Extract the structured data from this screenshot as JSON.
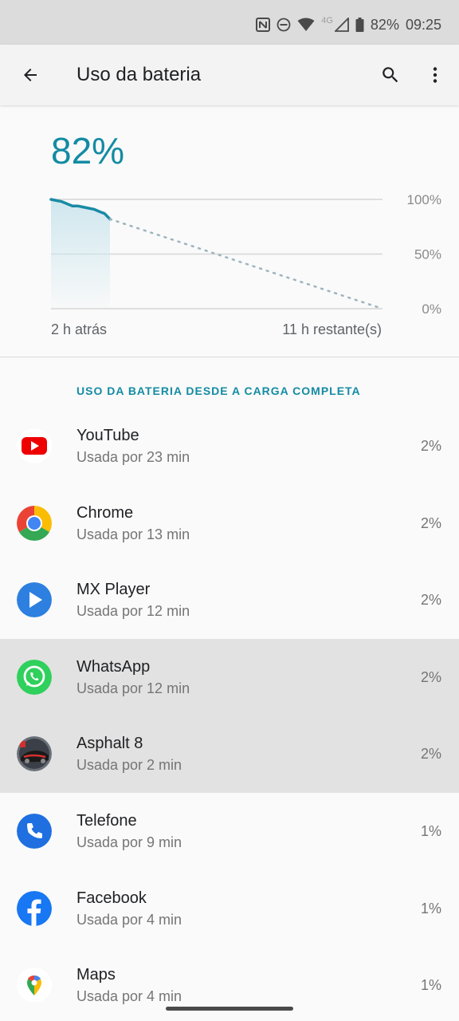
{
  "status_bar": {
    "network": "4G",
    "battery": "82%",
    "time": "09:25",
    "icons": [
      "nfc-icon",
      "do-not-disturb-icon",
      "wifi-icon",
      "signal-icon",
      "battery-icon"
    ]
  },
  "app_bar": {
    "title": "Uso da bateria",
    "icons": [
      "back-arrow-icon",
      "search-icon",
      "more-vert-icon"
    ]
  },
  "battery": {
    "level": "82%",
    "since_label": "2 h atrás",
    "remaining_label": "11 h restante(s)"
  },
  "chart_data": {
    "type": "line",
    "yticks": [
      "100%",
      "50%",
      "0%"
    ],
    "ylim": [
      0,
      100
    ],
    "series": [
      {
        "values": [
          100,
          99,
          98,
          96,
          94,
          94,
          93,
          92,
          91,
          89,
          87,
          82
        ],
        "style": "solid"
      },
      {
        "values_start": 82,
        "values_end": 0,
        "style": "dotted"
      }
    ],
    "xlabel_left": "2 h atrás",
    "xlabel_right": "11 h restante(s)",
    "colors": {
      "line": "#1a8ba5",
      "fill": "#cde6ee",
      "projection": "#9db4be",
      "grid": "#d5d5d5"
    }
  },
  "section": {
    "header": "USO DA BATERIA DESDE A CARGA COMPLETA"
  },
  "apps": [
    {
      "name": "YouTube",
      "usage": "Usada por 23 min",
      "percent": "2%",
      "icon": "youtube-icon"
    },
    {
      "name": "Chrome",
      "usage": "Usada por 13 min",
      "percent": "2%",
      "icon": "chrome-icon"
    },
    {
      "name": "MX Player",
      "usage": "Usada por 12 min",
      "percent": "2%",
      "icon": "mx-player-icon"
    },
    {
      "name": "WhatsApp",
      "usage": "Usada por 12 min",
      "percent": "2%",
      "icon": "whatsapp-icon"
    },
    {
      "name": "Asphalt 8",
      "usage": "Usada por 2 min",
      "percent": "2%",
      "icon": "asphalt-8-icon"
    },
    {
      "name": "Telefone",
      "usage": "Usada por 9 min",
      "percent": "1%",
      "icon": "phone-icon"
    },
    {
      "name": "Facebook",
      "usage": "Usada por 4 min",
      "percent": "1%",
      "icon": "facebook-icon"
    },
    {
      "name": "Maps",
      "usage": "Usada por 4 min",
      "percent": "1%",
      "icon": "maps-icon"
    }
  ],
  "colors": {
    "accent": "#138ba3",
    "highlight_row": "#e2e2e2"
  }
}
